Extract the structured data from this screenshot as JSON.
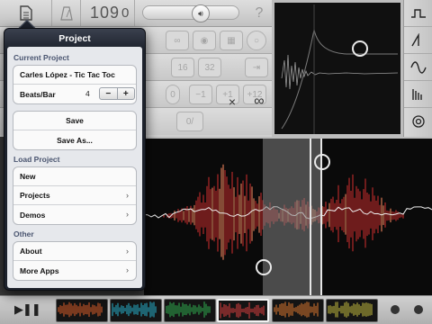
{
  "toolbar": {
    "bpm": "109",
    "bpm_decimal": "0",
    "help": "?"
  },
  "controls": {
    "row3_values": [
      "16",
      "32"
    ],
    "row4_values": [
      "−1",
      "+1",
      "+12"
    ],
    "row5_value": "0/",
    "close_glyph": "×",
    "loop_glyph": "∞"
  },
  "popover": {
    "title": "Project",
    "current_section": "Current Project",
    "project_name": "Carles López - Tic Tac Toc",
    "beats_label": "Beats/Bar",
    "beats_value": "4",
    "minus": "−",
    "plus": "+",
    "save": "Save",
    "save_as": "Save As...",
    "load_section": "Load Project",
    "new": "New",
    "projects": "Projects",
    "demos": "Demos",
    "other_section": "Other",
    "about": "About",
    "more_apps": "More Apps",
    "chevron": "›"
  },
  "colors": {
    "popover_header": "#1d222c",
    "waveform_red": "#c02a2a",
    "selection": "#8a8a8a"
  }
}
